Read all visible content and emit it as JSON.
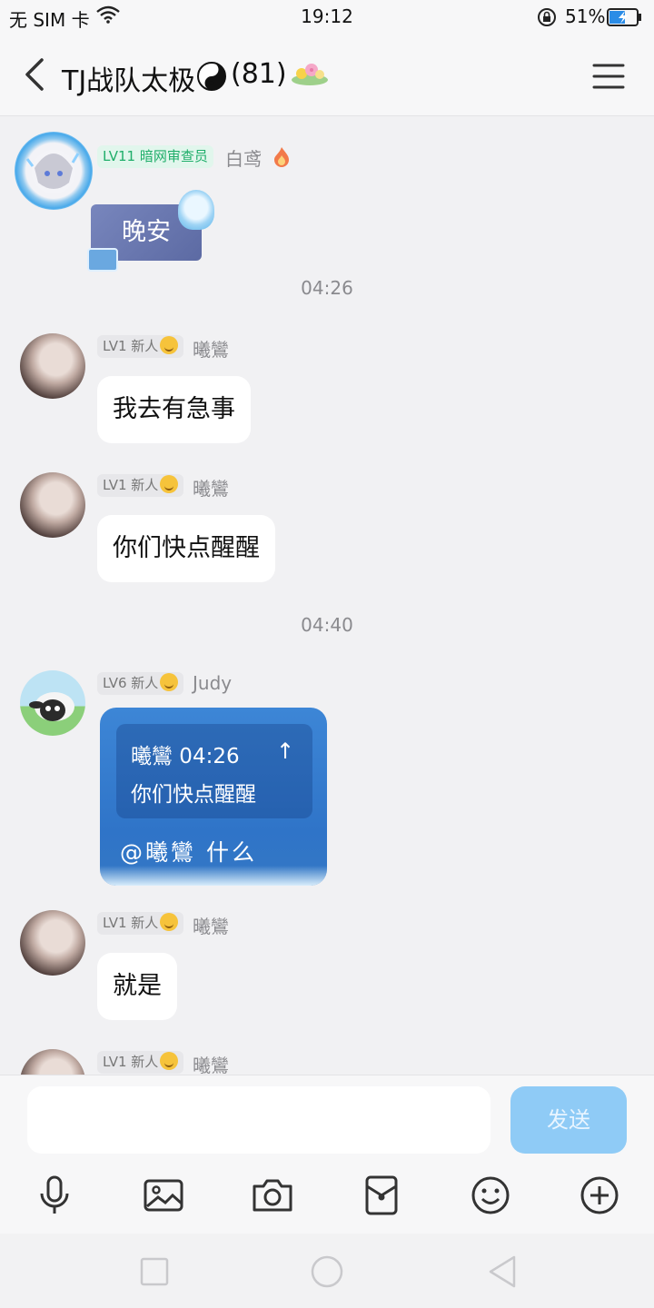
{
  "status_bar": {
    "carrier": "无 SIM 卡",
    "time": "19:12",
    "battery_percent": "51%",
    "icons": [
      "wifi-icon",
      "rotation-lock-icon",
      "battery-charging-icon"
    ]
  },
  "header": {
    "title": "TJ战队太极",
    "member_count": "(81)",
    "icons": [
      "back-arrow-icon",
      "yinyang-icon",
      "flower-icon",
      "menu-icon"
    ]
  },
  "messages": [
    {
      "badge": "LV11 暗网审查员",
      "sender": "白鸢",
      "text": "晚安"
    },
    {
      "timestamp": "04:26"
    },
    {
      "badge": "LV1 新人",
      "sender": "曦鸞",
      "text": "我去有急事"
    },
    {
      "badge": "LV1 新人",
      "sender": "曦鸞",
      "text": "你们快点醒醒"
    },
    {
      "timestamp": "04:40"
    },
    {
      "badge": "LV6 新人",
      "sender": "Judy",
      "quote": {
        "author_time": "曦鸞 04:26",
        "text": "你们快点醒醒"
      },
      "text": "@曦鸞 什么"
    },
    {
      "badge": "LV1 新人",
      "sender": "曦鸞",
      "text": "就是"
    },
    {
      "badge": "LV1 新人",
      "sender": "曦鸞"
    }
  ],
  "composer": {
    "input_value": "",
    "send_label": "发送",
    "tools": [
      "microphone-icon",
      "image-icon",
      "camera-icon",
      "red-packet-icon",
      "emoji-icon",
      "plus-icon"
    ]
  },
  "colors": {
    "background": "#f1f1f3",
    "bubble": "#ffffff",
    "send_button": "#8fcbf6",
    "quote_bubble": "#2f74c8",
    "badge_green": "#1fae6a"
  }
}
